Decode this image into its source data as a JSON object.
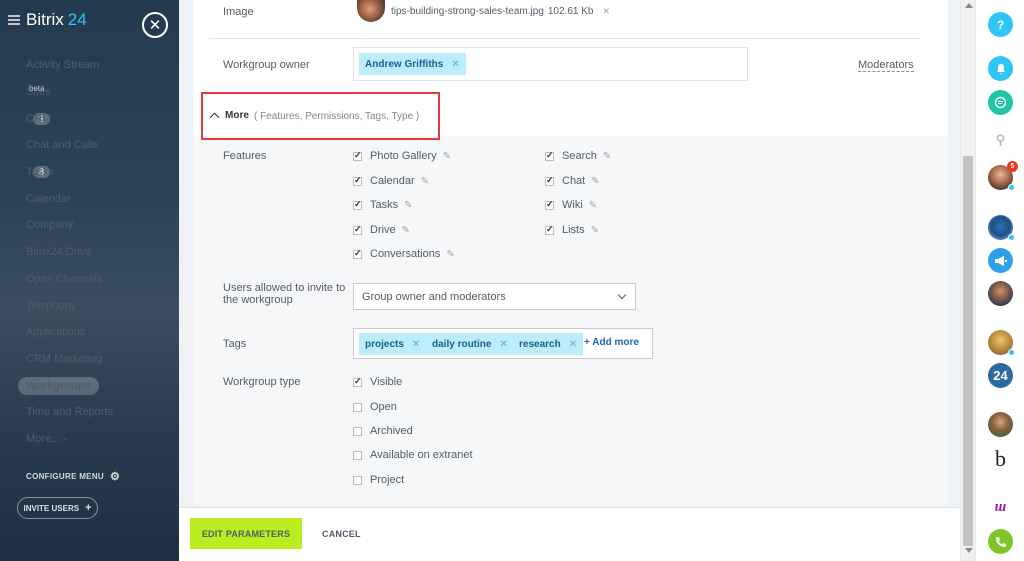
{
  "sidebar": {
    "logo_text": "Bitrix",
    "logo_num": "24",
    "items": [
      {
        "label": "Activity Stream"
      },
      {
        "label": "Sites",
        "sup": "beta"
      },
      {
        "label": "CRM",
        "counter": "3"
      },
      {
        "label": "Chat and Calls"
      },
      {
        "label": "Tasks",
        "counter": "8"
      },
      {
        "label": "Calendar"
      },
      {
        "label": "Company"
      },
      {
        "label": "Bitrix24.Drive"
      },
      {
        "label": "Open Channels"
      },
      {
        "label": "Telephony"
      },
      {
        "label": "Applications"
      },
      {
        "label": "CRM Marketing"
      },
      {
        "label": "Workgroups",
        "active": true
      },
      {
        "label": "Time and Reports"
      },
      {
        "label": "More... -"
      }
    ],
    "configure_menu": "CONFIGURE MENU",
    "invite_users": "INVITE USERS"
  },
  "form": {
    "image_label": "Image",
    "image_file": "tips-building-strong-sales-team.jpg",
    "image_size": "102.61 Kb",
    "owner_label": "Workgroup owner",
    "owner_name": "Andrew Griffiths",
    "moderators_link": "Moderators",
    "more_title": "More",
    "more_sub": "( Features,  Permissions, Tags,  Type  )",
    "features_label": "Features",
    "features_left": [
      {
        "label": "Photo Gallery",
        "checked": true
      },
      {
        "label": "Calendar",
        "checked": true
      },
      {
        "label": "Tasks",
        "checked": true
      },
      {
        "label": "Drive",
        "checked": true
      },
      {
        "label": "Conversations",
        "checked": true
      }
    ],
    "features_right": [
      {
        "label": "Search",
        "checked": true
      },
      {
        "label": "Chat",
        "checked": true
      },
      {
        "label": "Wiki",
        "checked": true
      },
      {
        "label": "Lists",
        "checked": true
      }
    ],
    "invite_label_1": "Users allowed to invite to",
    "invite_label_2": "the workgroup",
    "invite_value": "Group owner and moderators",
    "tags_label": "Tags",
    "tags": [
      "projects",
      "daily routine",
      "research"
    ],
    "add_more": "+ Add more",
    "type_label": "Workgroup type",
    "types": [
      {
        "label": "Visible",
        "checked": true
      },
      {
        "label": "Open",
        "checked": false
      },
      {
        "label": "Archived",
        "checked": false
      },
      {
        "label": "Available on extranet",
        "checked": false
      },
      {
        "label": "Project",
        "checked": false
      }
    ]
  },
  "footer": {
    "edit_button": "EDIT PARAMETERS",
    "cancel_button": "CANCEL"
  },
  "rightbar": {
    "help": "?",
    "notification_count": "5",
    "bitrix_label": "24",
    "b_label": "b"
  },
  "colors": {
    "accent_green": "#bbed21",
    "tag_bg": "#bcedfc",
    "highlight_red": "#e03c3c",
    "icon_blue": "#2fc6f6"
  }
}
